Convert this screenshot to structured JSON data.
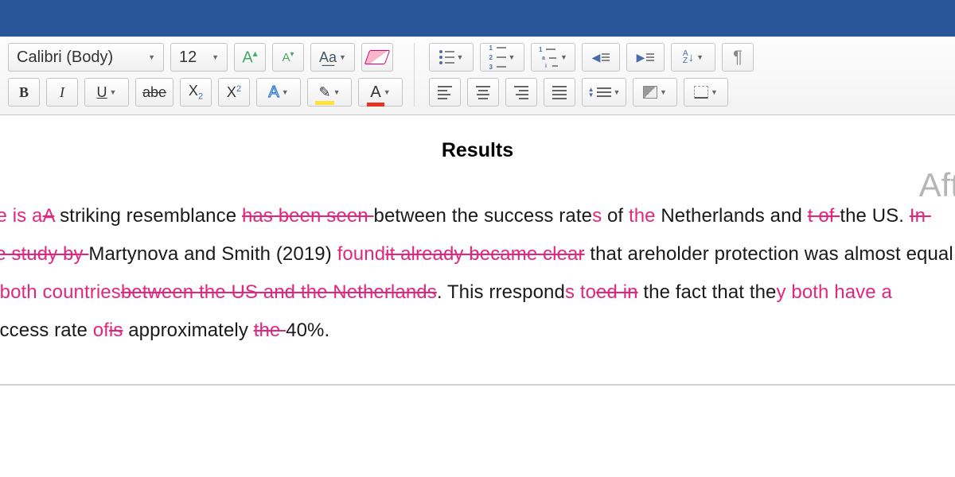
{
  "toolbar": {
    "font_name": "Calibri (Body)",
    "font_size": "12"
  },
  "document": {
    "heading": "Results",
    "watermark": "Aft",
    "segments": [
      {
        "t": "ins",
        "v": "ere is a"
      },
      {
        "t": "del",
        "v": "A"
      },
      {
        "t": "n",
        "v": " striking resemblance "
      },
      {
        "t": "del",
        "v": "has been seen "
      },
      {
        "t": "n",
        "v": "between the success rate"
      },
      {
        "t": "ins",
        "v": "s"
      },
      {
        "t": "n",
        "v": " of "
      },
      {
        "t": "ins",
        "v": "the"
      },
      {
        "t": "n",
        "v": " Netherlands and "
      },
      {
        "t": "del",
        "v": "t of "
      },
      {
        "t": "n",
        "v": "the US. "
      },
      {
        "t": "del",
        "v": "In the study by "
      },
      {
        "t": "n",
        "v": "Martynova and Smith (2019) "
      },
      {
        "t": "ins",
        "v": "found"
      },
      {
        "t": "del",
        "v": "it already became clear"
      },
      {
        "t": "n",
        "v": " that areholder protection was almost equal "
      },
      {
        "t": "ins",
        "v": "in both countries"
      },
      {
        "t": "del",
        "v": "between the US and the Netherlands"
      },
      {
        "t": "n",
        "v": ". This rrespond"
      },
      {
        "t": "ins",
        "v": "s to"
      },
      {
        "t": "del",
        "v": "ed in"
      },
      {
        "t": "n",
        "v": " the fact that the"
      },
      {
        "t": "ins",
        "v": "y both have a"
      },
      {
        "t": "n",
        "v": " success rate "
      },
      {
        "t": "ins",
        "v": "of"
      },
      {
        "t": "del",
        "v": "is"
      },
      {
        "t": "n",
        "v": " approximately "
      },
      {
        "t": "del",
        "v": "the "
      },
      {
        "t": "n",
        "v": "40%."
      }
    ]
  }
}
